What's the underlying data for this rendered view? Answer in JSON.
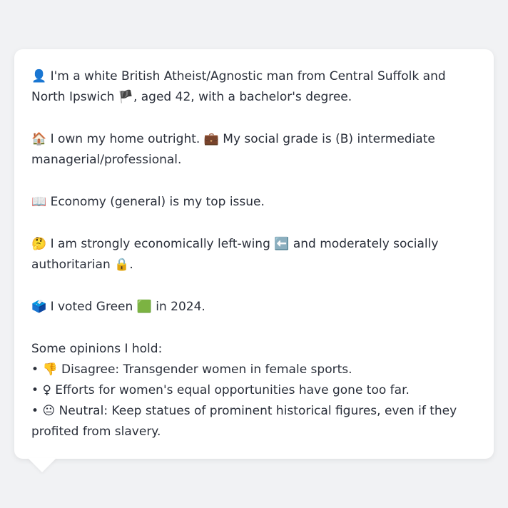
{
  "profile": {
    "identity": {
      "icon": "👤",
      "text": "I'm a white British Atheist/Agnostic man from Central Suffolk and North Ipswich",
      "flag": "🏴",
      "suffix": ", aged 42, with a bachelor's degree."
    },
    "home": {
      "icon": "🏠",
      "text": "I own my home outright.",
      "grade_icon": "💼",
      "grade_text": "My social grade is (B) intermediate managerial/professional."
    },
    "issue": {
      "icon": "📖",
      "text": "Economy (general) is my top issue."
    },
    "ideology": {
      "icon": "🤔",
      "text_a": "I am strongly economically left-wing",
      "left_icon": "⬅️",
      "text_b": "and moderately socially authoritarian",
      "lock_icon": "🔒",
      "end": "."
    },
    "vote": {
      "icon": "🗳️",
      "text_a": "I voted Green",
      "party_icon": "🟩",
      "text_b": "in 2024."
    }
  },
  "opinions": {
    "heading": "Some opinions I hold:",
    "items": [
      {
        "bullet": "•",
        "icon": "👎",
        "text": "Disagree: Transgender women in female sports."
      },
      {
        "bullet": "•",
        "icon": "♀",
        "text": "Efforts for women's equal opportunities have gone too far."
      },
      {
        "bullet": "•",
        "icon": "😐",
        "text": "Neutral: Keep statues of prominent historical figures, even if they profited from slavery."
      }
    ]
  }
}
